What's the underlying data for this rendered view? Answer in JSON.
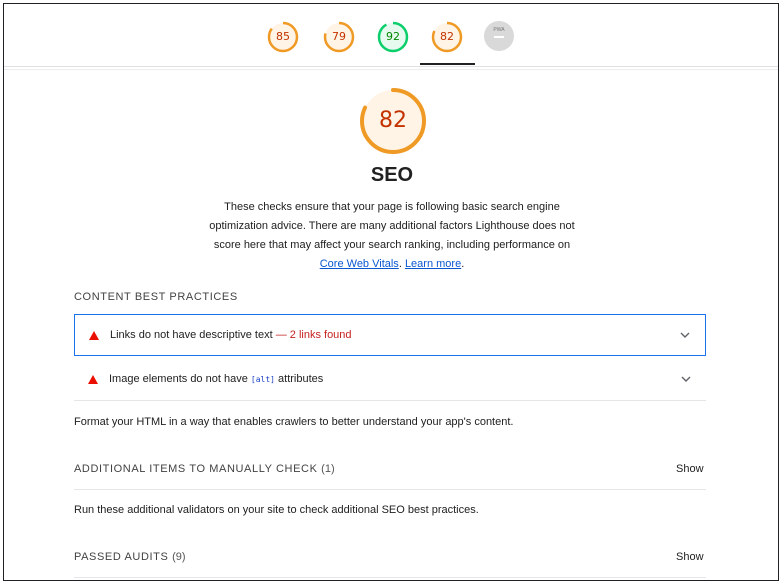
{
  "topbar": {
    "gauges": [
      {
        "score": "85",
        "color": "#f09a26"
      },
      {
        "score": "79",
        "color": "#f09a26"
      },
      {
        "score": "92",
        "color": "#0cce6b"
      },
      {
        "score": "82",
        "color": "#f09a26"
      }
    ],
    "na_label": "PWA"
  },
  "category": {
    "score": "82",
    "score_fraction": 0.82,
    "accent_color": "#f09a26",
    "title": "SEO",
    "description_prefix": "These checks ensure that your page is following basic search engine optimization advice. There are many additional factors Lighthouse does not score here that may affect your search ranking, including performance on ",
    "core_web_vitals_link": "Core Web Vitals",
    "separator": ". ",
    "learn_more_link": "Learn more",
    "suffix": "."
  },
  "content_best_practices": {
    "title": "CONTENT BEST PRACTICES",
    "audits": [
      {
        "label": "Links do not have descriptive text",
        "detail": "— 2 links found"
      },
      {
        "label_before": "Image elements do not have ",
        "code": "[alt]",
        "label_after": " attributes"
      }
    ],
    "footer": "Format your HTML in a way that enables crawlers to better understand your app's content."
  },
  "manual": {
    "title": "ADDITIONAL ITEMS TO MANUALLY CHECK",
    "count": "(1)",
    "show": "Show",
    "description": "Run these additional validators on your site to check additional SEO best practices."
  },
  "passed": {
    "title": "PASSED AUDITS",
    "count": "(9)",
    "show": "Show"
  },
  "colors": {
    "fail": "#eb0f00",
    "average": "#f09a26",
    "pass": "#0cce6b",
    "link": "#0b57d0"
  }
}
